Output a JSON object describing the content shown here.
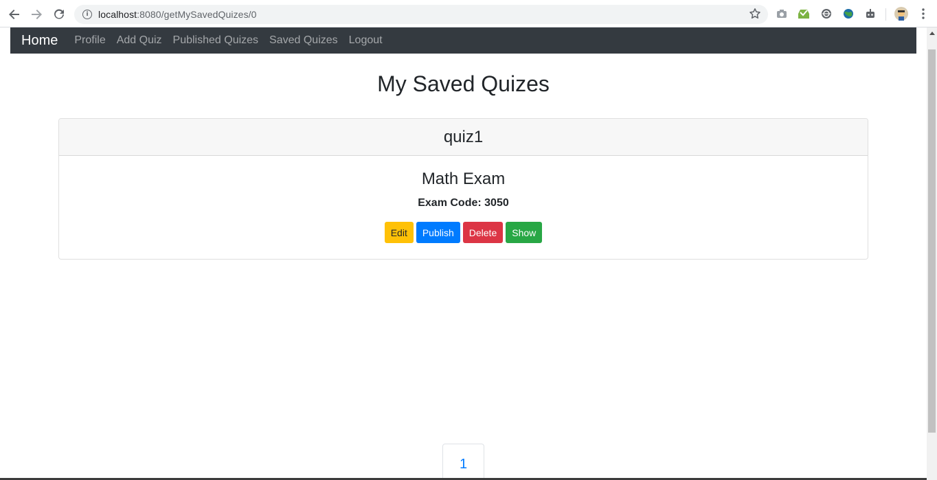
{
  "browser": {
    "url_host": "localhost",
    "url_path": ":8080/getMySavedQuizes/0",
    "icons": [
      "back-icon",
      "forward-icon",
      "reload-icon",
      "info-icon",
      "star-icon",
      "camera-icon",
      "extension-icon",
      "extension-icon",
      "extension-icon",
      "extension-icon",
      "avatar",
      "menu-icon"
    ]
  },
  "navbar": {
    "brand": "Home",
    "links": [
      "Profile",
      "Add Quiz",
      "Published Quizes",
      "Saved Quizes",
      "Logout"
    ]
  },
  "page": {
    "title": "My Saved Quizes"
  },
  "quiz": {
    "header": "quiz1",
    "title": "Math Exam",
    "code_label": "Exam Code: 3050",
    "buttons": {
      "edit": "Edit",
      "publish": "Publish",
      "delete": "Delete",
      "show": "Show"
    }
  },
  "pagination": {
    "current": "1"
  },
  "colors": {
    "navbar": "#343a40",
    "warning": "#ffc107",
    "primary": "#007bff",
    "danger": "#dc3545",
    "success": "#28a745"
  }
}
